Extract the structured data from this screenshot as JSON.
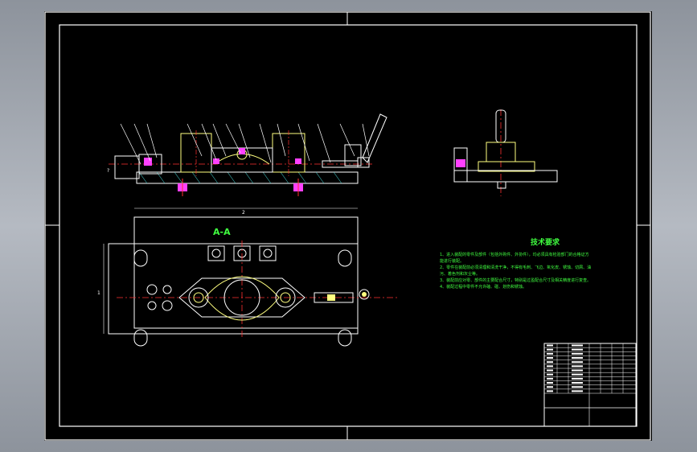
{
  "drawing": {
    "section_label": "A-A",
    "dimension_width": "2",
    "dimension_height": "1",
    "side_label": "?"
  },
  "tech_requirements": {
    "title": "技术要求",
    "lines": [
      "1、进入装配的零件及部件（包括外购件、外协件），均必须具有检验部门的合格证方",
      "能进行装配。",
      "2、零件在装配前必须清理和清洗干净，不得有毛刺、飞边、氧化皮、锈蚀、切屑、油",
      "污、着色剂和灰尘等。",
      "3、装配前应对零、部件的主要配合尺寸，特别是过盈配合尺寸及相关精度进行复查。",
      "4、装配过程中零件不允许磕、碰、划伤和锈蚀。"
    ]
  },
  "title_block": {
    "rows": 12
  },
  "colors": {
    "background": "#000000",
    "outline": "#ffffff",
    "body": "#ffff80",
    "centerline": "#ff3030",
    "hatch": "#40c0c0",
    "magenta": "#ff40ff",
    "text_green": "#40ff40"
  }
}
